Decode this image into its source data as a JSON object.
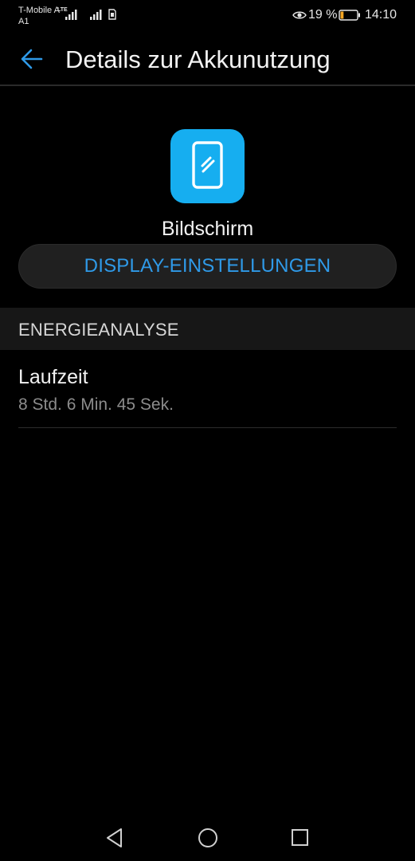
{
  "status_bar": {
    "carrier_line1": "T-Mobile A",
    "carrier_line2": "A1",
    "lte_label": "LTE",
    "battery_percent": "19 %",
    "time": "14:10",
    "battery_level": 0.19,
    "battery_color": "#f5a623"
  },
  "app_bar": {
    "title": "Details zur Akkunutzung",
    "back_icon": "arrow-left-icon",
    "accent_color": "#2f9ae8"
  },
  "header": {
    "icon": "phone-screen-icon",
    "icon_color": "#16aef0",
    "app_name": "Bildschirm",
    "settings_button_label": "DISPLAY-EINSTELLUNGEN"
  },
  "section": {
    "title": "ENERGIEANALYSE",
    "items": [
      {
        "label": "Laufzeit",
        "value": "8 Std. 6 Min. 45 Sek."
      }
    ]
  },
  "nav_bar": {
    "back": "triangle-back-icon",
    "home": "circle-home-icon",
    "recents": "square-recents-icon"
  }
}
